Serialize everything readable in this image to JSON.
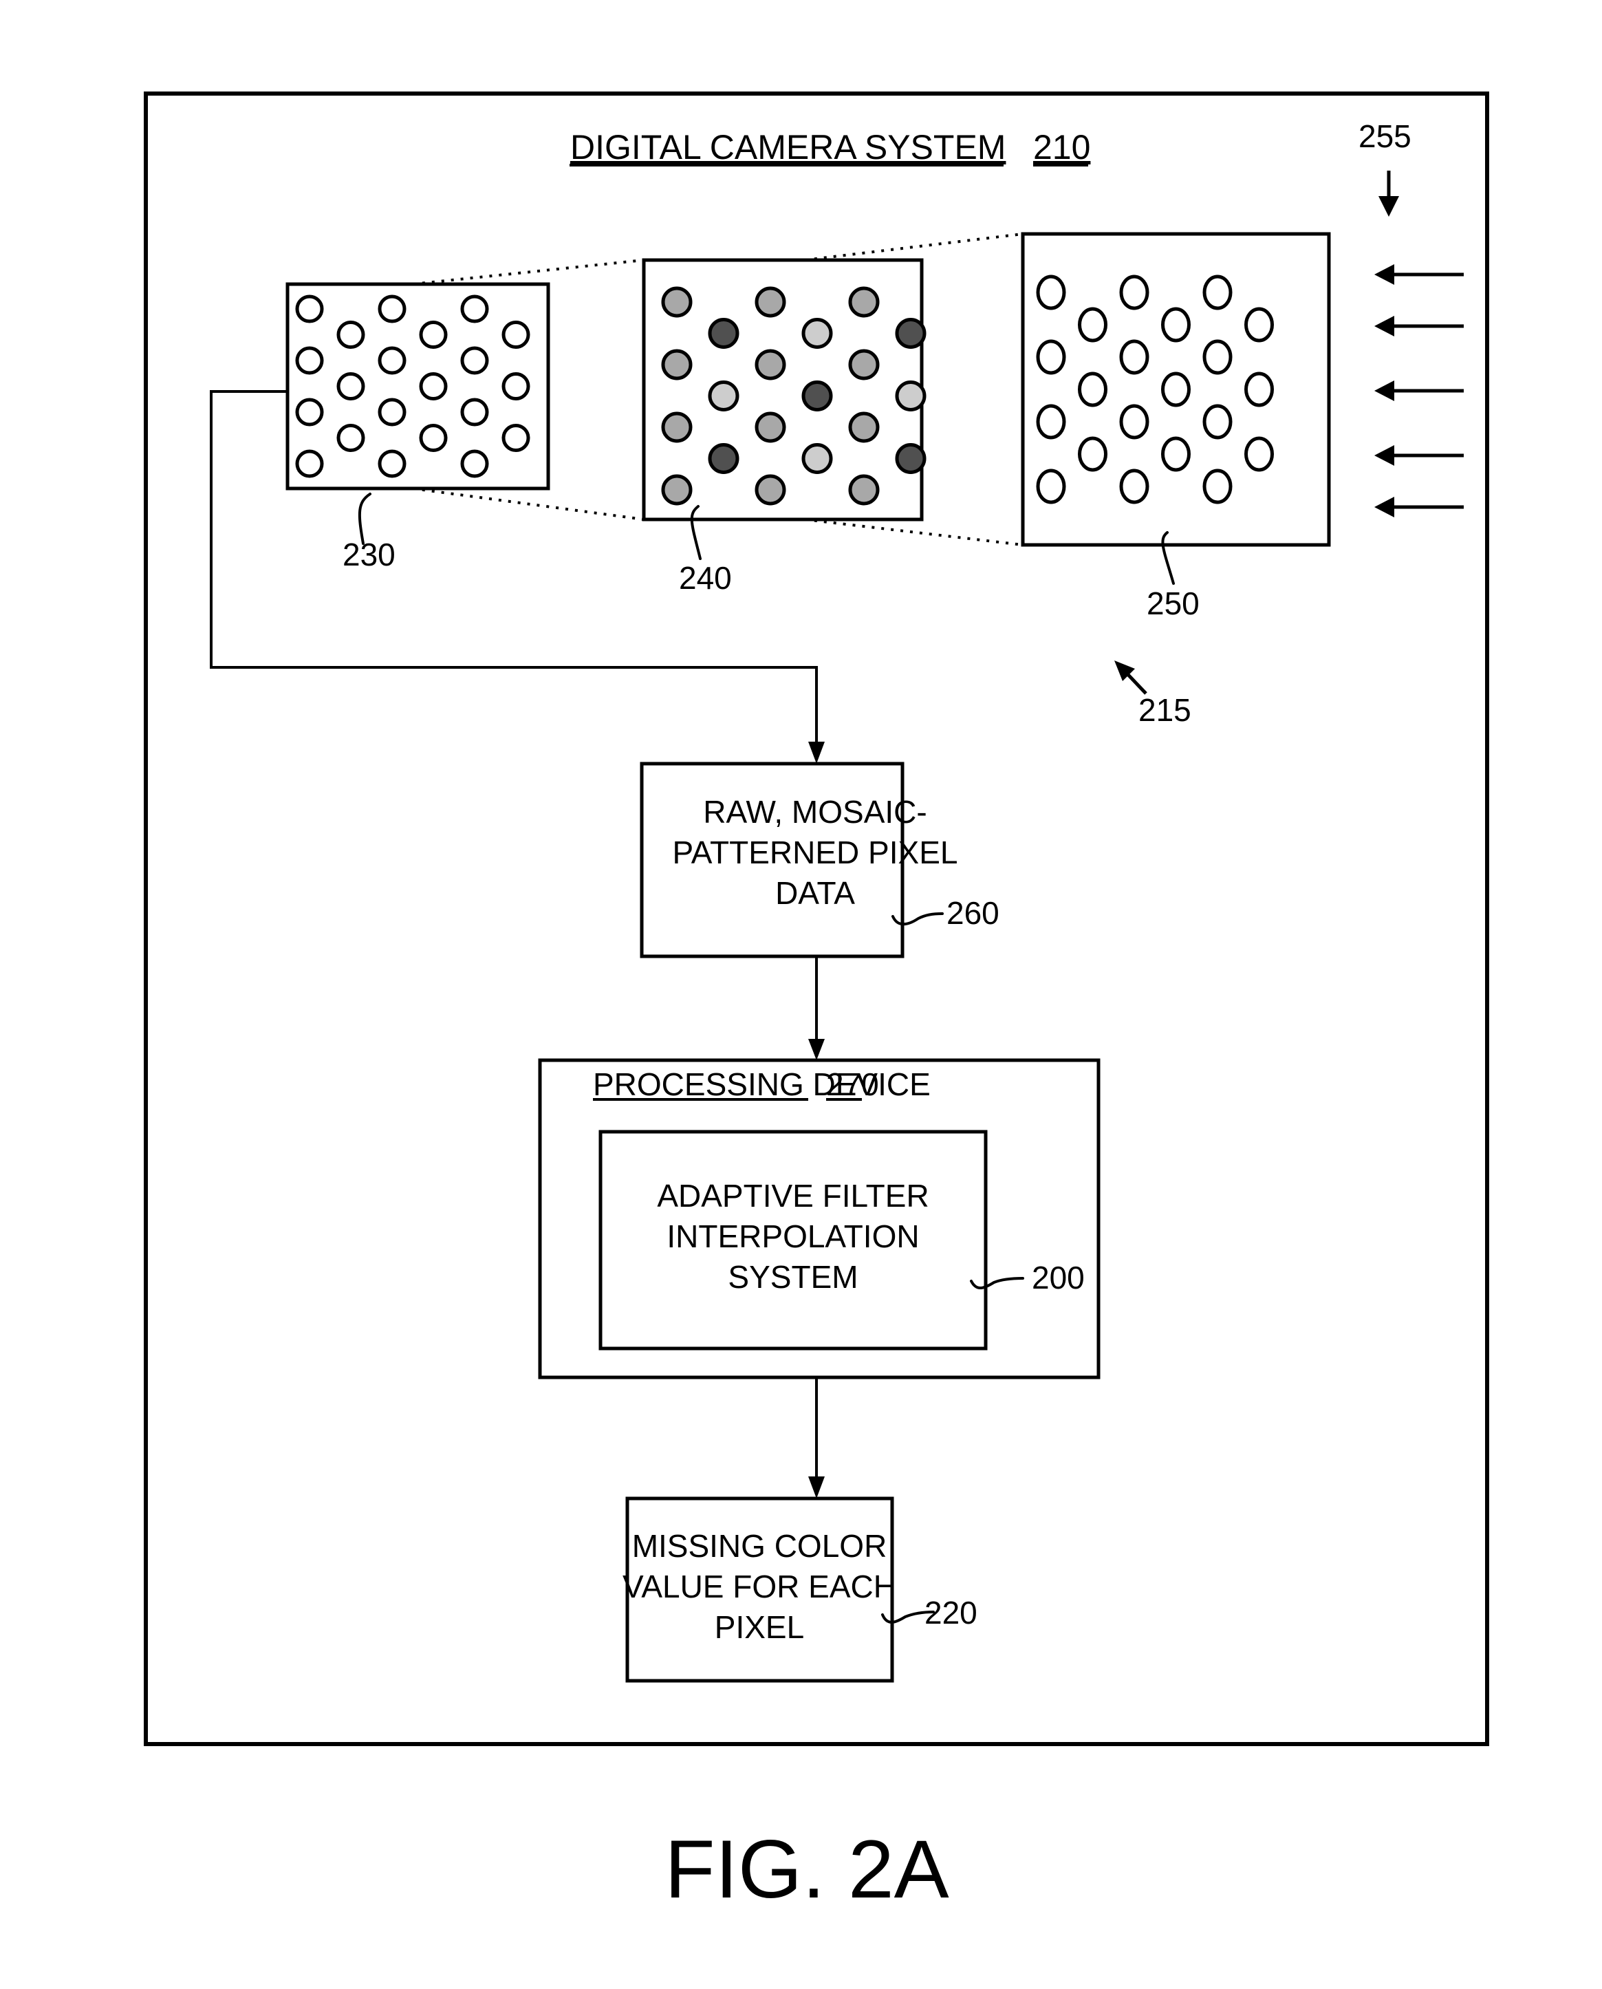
{
  "figure": {
    "label": "FIG. 2A",
    "system": {
      "title": "DIGITAL CAMERA SYSTEM",
      "ref": "210"
    },
    "refs": {
      "sensor": "230",
      "color_filter_array": "240",
      "lens_array": "250",
      "incident_light": "255",
      "imaging_assembly": "215"
    },
    "color_filter_pattern": {
      "rows": [
        [
          "medium",
          "dark",
          "medium",
          "light",
          "medium",
          "dark"
        ],
        [
          "medium",
          "light",
          "medium",
          "dark",
          "medium",
          "light"
        ],
        [
          "medium",
          "dark",
          "medium",
          "light",
          "medium",
          "dark"
        ],
        [
          "medium",
          "",
          "medium",
          "",
          "medium",
          ""
        ]
      ],
      "shades": {
        "medium": "#a8a8a8",
        "dark": "#505050",
        "light": "#cdcdcd"
      }
    },
    "blocks": {
      "raw_data": {
        "lines": [
          "RAW, MOSAIC-",
          "PATTERNED PIXEL",
          "DATA"
        ],
        "ref": "260"
      },
      "processing_device": {
        "title": "PROCESSING DEVICE",
        "ref": "270"
      },
      "interpolation_system": {
        "lines": [
          "ADAPTIVE FILTER",
          "INTERPOLATION",
          "SYSTEM"
        ],
        "ref": "200"
      },
      "output": {
        "lines": [
          "MISSING COLOR",
          "VALUE FOR EACH",
          "PIXEL"
        ],
        "ref": "220"
      }
    }
  }
}
